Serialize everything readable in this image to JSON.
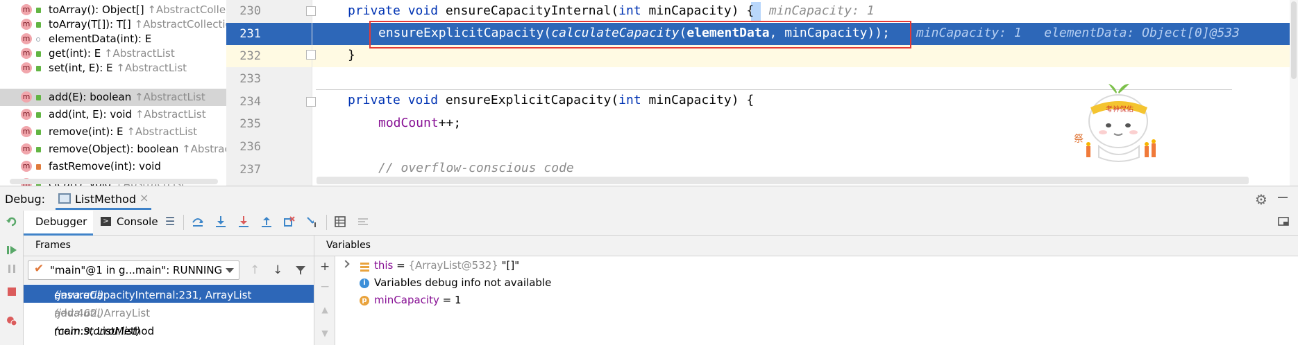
{
  "structure": {
    "items": [
      {
        "name": "toArray(): Object[]",
        "inherited": "↑AbstractCollec",
        "vis": "pub"
      },
      {
        "name": "toArray(T[]): T[]",
        "inherited": "↑AbstractCollection",
        "vis": "pub"
      },
      {
        "name": "elementData(int): E",
        "inherited": "",
        "vis": "pkg"
      },
      {
        "name": "get(int): E",
        "inherited": "↑AbstractList",
        "vis": "pub"
      },
      {
        "name": "set(int, E): E",
        "inherited": "↑AbstractList",
        "vis": "pub"
      },
      {
        "name": "add(E): boolean",
        "inherited": "↑AbstractList",
        "vis": "pub"
      },
      {
        "name": "add(int, E): void",
        "inherited": "↑AbstractList",
        "vis": "pub"
      },
      {
        "name": "remove(int): E",
        "inherited": "↑AbstractList",
        "vis": "pub"
      },
      {
        "name": "remove(Object): boolean",
        "inherited": "↑Abstrac",
        "vis": "pub"
      },
      {
        "name": "fastRemove(int): void",
        "inherited": "",
        "vis": "priv"
      },
      {
        "name": "clear(): void",
        "inherited": "↑AbstractList",
        "vis": "pub"
      }
    ],
    "method_badge": "m"
  },
  "editor": {
    "line_numbers": [
      "230",
      "231",
      "232",
      "233",
      "234",
      "235",
      "236",
      "237"
    ],
    "line230": {
      "kw1": "private",
      "kw2": "void",
      "name": "ensureCapacityInternal(",
      "kw3": "int",
      "param": "minCapacity) {",
      "hint": "minCapacity: 1"
    },
    "line231": {
      "call": "ensureExplicitCapacity(",
      "inner": "calculateCapacity",
      "open": "(",
      "field": "elementData",
      "rest": ", minCapacity));",
      "hint1": "minCapacity: 1",
      "hint2": "elementData: Object[0]@533"
    },
    "line232": {
      "text": "}"
    },
    "line234": {
      "kw1": "private",
      "kw2": "void",
      "name": "ensureExplicitCapacity(",
      "kw3": "int",
      "param": "minCapacity) {"
    },
    "line235": {
      "field": "modCount",
      "rest": "++;"
    },
    "line237": {
      "comment": "// overflow-conscious code"
    }
  },
  "mascot": {
    "headband": "考神保佑",
    "side_text": "祭"
  },
  "debug": {
    "title": "Debug:",
    "config_tab": "ListMethod",
    "close_glyph": "×",
    "tabs": {
      "debugger": "Debugger",
      "console": "Console"
    },
    "frames": {
      "title": "Frames",
      "thread": "\"main\"@1 in g...main\": RUNNING",
      "items": [
        {
          "method": "ensureCapacityInternal:231, ArrayList",
          "pkg": "(java.util)"
        },
        {
          "method": "add:462, ArrayList",
          "pkg": "(java.util)"
        },
        {
          "method": "main:9, ListMethod",
          "pkg": "(com.storror.list)"
        }
      ]
    },
    "variables": {
      "title": "Variables",
      "items": [
        {
          "name": "this",
          "eq": " = ",
          "type": "{ArrayList@532}",
          "value": " \"[]\""
        },
        {
          "text": "Variables debug info not available"
        },
        {
          "name": "minCapacity",
          "eq": " = ",
          "value": "1"
        }
      ]
    }
  },
  "colors": {
    "selection_blue": "#2d67b8",
    "keyword": "#0033b3",
    "field": "#871094",
    "highlight_box": "#e53935"
  }
}
